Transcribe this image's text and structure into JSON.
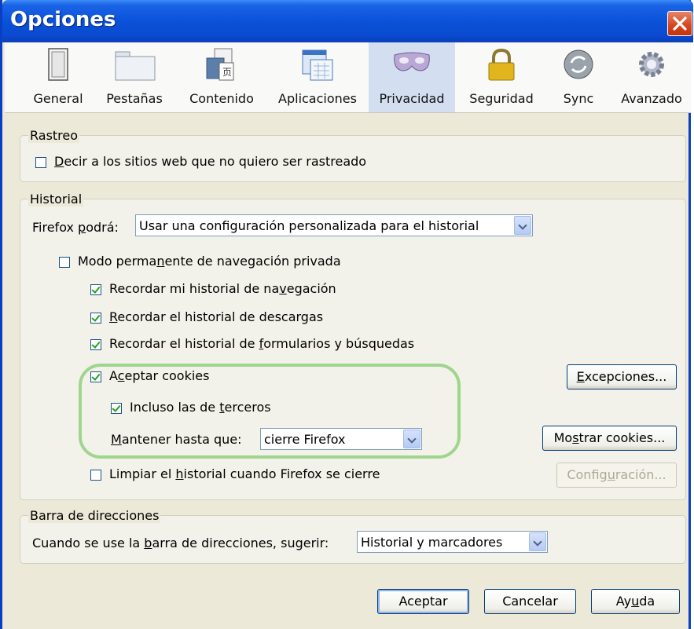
{
  "window": {
    "title": "Opciones"
  },
  "toolbar": {
    "items": [
      {
        "label": "General",
        "icon": "general-icon"
      },
      {
        "label": "Pestañas",
        "icon": "tabs-icon"
      },
      {
        "label": "Contenido",
        "icon": "content-icon"
      },
      {
        "label": "Aplicaciones",
        "icon": "applications-icon"
      },
      {
        "label": "Privacidad",
        "icon": "mask-icon",
        "active": true
      },
      {
        "label": "Seguridad",
        "icon": "lock-icon"
      },
      {
        "label": "Sync",
        "icon": "sync-icon"
      },
      {
        "label": "Avanzado",
        "icon": "gear-icon"
      }
    ]
  },
  "tracking": {
    "legend": "Rastreo",
    "do_not_track": {
      "pre": "",
      "key": "D",
      "post": "ecir a los sitios web que no quiero ser rastreado",
      "checked": false
    }
  },
  "history": {
    "legend": "Historial",
    "firefox_will": {
      "pre": "Firefox ",
      "key": "p",
      "post": "odrá:"
    },
    "mode_select": "Usar una configuración personalizada para el historial",
    "private_mode": {
      "pre": "Modo perma",
      "key": "n",
      "post": "ente de navegación privada",
      "checked": false
    },
    "remember_history": {
      "pre": "Recordar mi historial de na",
      "key": "v",
      "post": "egación",
      "checked": true
    },
    "remember_downloads": {
      "pre": "",
      "key": "R",
      "post": "ecordar el historial de descargas",
      "checked": true
    },
    "remember_forms": {
      "pre": "Recordar el historial de ",
      "key": "f",
      "post": "ormularios y búsquedas",
      "checked": true
    },
    "accept_cookies": {
      "pre": "A",
      "key": "c",
      "post": "eptar cookies",
      "checked": true
    },
    "third_party": {
      "pre": "Incluso las de ",
      "key": "t",
      "post": "erceros",
      "checked": true
    },
    "keep_until": {
      "pre": "",
      "key": "M",
      "post": "antener hasta que:"
    },
    "keep_until_select": "cierre Firefox",
    "clear_on_close": {
      "pre": "Limpiar el ",
      "key": "h",
      "post": "istorial cuando Firefox se cierre",
      "checked": false
    },
    "exceptions_button": {
      "pre": "",
      "key": "E",
      "post": "xcepciones..."
    },
    "show_cookies_button": {
      "pre": "Mo",
      "key": "s",
      "post": "trar cookies..."
    },
    "settings_button": {
      "pre": "Config",
      "key": "u",
      "post": "ración..."
    }
  },
  "address_bar": {
    "legend": "Barra de direcciones",
    "suggest": {
      "pre": "Cuando se use la ",
      "key": "b",
      "post": "arra de direcciones, sugerir:"
    },
    "suggest_select": "Historial y marcadores"
  },
  "buttons": {
    "accept": "Aceptar",
    "cancel": "Cancelar",
    "help": {
      "pre": "Ay",
      "key": "u",
      "post": "da"
    }
  },
  "colors": {
    "titlebar": "#0a52d9",
    "highlight": "#9fd58c",
    "check": "#21a121"
  }
}
